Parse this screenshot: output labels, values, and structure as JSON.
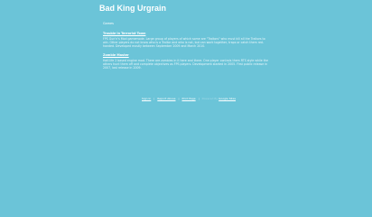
{
  "site": {
    "title": "Bad King Urgrain"
  },
  "main": {
    "section_heading": "Games",
    "posts": [
      {
        "title": "Trouble in Terrorist Town",
        "body": "FPS Gun'n's Mod gamemode. Large group of players of which some are \"Traitors\" who must kill all the Traitors to win. Other players do not know who is a Traitor and who is not, but can work together, traps or catch them red-handed. Developed mostly between September 2009 and March 2010."
      },
      {
        "title": "Zombie Master",
        "body": "Half-life 2 based engine mod. There are zombies in it here and there. One player controls them RTS style while the others hunt them off and complete objectives as FPS players. Development started in 2005. First public release in 2007, last release in 2009."
      }
    ]
  },
  "footer": {
    "links": [
      {
        "label": "Sign In"
      },
      {
        "label": "Report Abuse"
      },
      {
        "label": "Print Page"
      }
    ],
    "powered_by": "Powered By",
    "powered_link": "Google Sites"
  }
}
